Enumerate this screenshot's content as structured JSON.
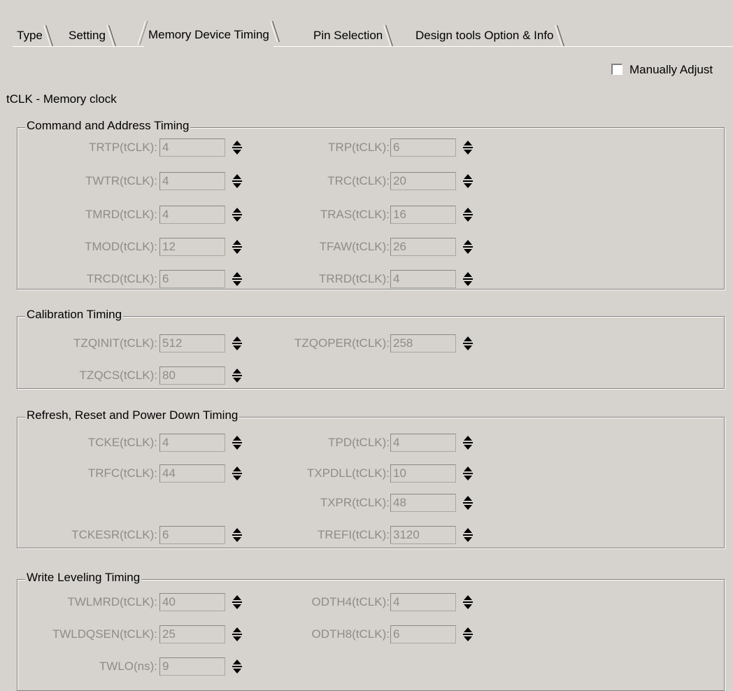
{
  "tabs": [
    {
      "label": "Type"
    },
    {
      "label": "Setting"
    },
    {
      "label": "Memory Device Timing",
      "active": true
    },
    {
      "label": "Pin Selection"
    },
    {
      "label": "Design tools Option & Info"
    }
  ],
  "manual_adjust": {
    "label": "Manually Adjust",
    "checked": false
  },
  "clock_label": "tCLK - Memory clock",
  "groups": {
    "command": {
      "title": "Command and Address Timing",
      "fields": [
        {
          "label": "TRTP(tCLK):",
          "value": "4"
        },
        {
          "label": "TRP(tCLK):",
          "value": "6"
        },
        {
          "label": "TWTR(tCLK):",
          "value": "4"
        },
        {
          "label": "TRC(tCLK):",
          "value": "20"
        },
        {
          "label": "TMRD(tCLK):",
          "value": "4"
        },
        {
          "label": "TRAS(tCLK):",
          "value": "16"
        },
        {
          "label": "TMOD(tCLK):",
          "value": "12"
        },
        {
          "label": "TFAW(tCLK):",
          "value": "26"
        },
        {
          "label": "TRCD(tCLK):",
          "value": "6"
        },
        {
          "label": "TRRD(tCLK):",
          "value": "4"
        }
      ]
    },
    "calibration": {
      "title": "Calibration Timing",
      "fields": [
        {
          "label": "TZQINIT(tCLK):",
          "value": "512"
        },
        {
          "label": "TZQOPER(tCLK):",
          "value": "258"
        },
        {
          "label": "TZQCS(tCLK):",
          "value": "80"
        }
      ]
    },
    "refresh": {
      "title": "Refresh, Reset and Power Down Timing",
      "fields": [
        {
          "label": "TCKE(tCLK):",
          "value": "4"
        },
        {
          "label": "TPD(tCLK):",
          "value": "4"
        },
        {
          "label": "TRFC(tCLK):",
          "value": "44"
        },
        {
          "label": "TXPDLL(tCLK):",
          "value": "10"
        },
        {
          "label": "TXPR(tCLK):",
          "value": "48"
        },
        {
          "label": "TCKESR(tCLK):",
          "value": "6"
        },
        {
          "label": "TREFI(tCLK):",
          "value": "3120"
        }
      ]
    },
    "write": {
      "title": "Write Leveling Timing",
      "fields": [
        {
          "label": "TWLMRD(tCLK):",
          "value": "40"
        },
        {
          "label": "ODTH4(tCLK):",
          "value": "4"
        },
        {
          "label": "TWLDQSEN(tCLK):",
          "value": "25"
        },
        {
          "label": "ODTH8(tCLK):",
          "value": "6"
        },
        {
          "label": "TWLO(ns):",
          "value": "9"
        }
      ]
    }
  },
  "colors": {
    "background": "#d6d3ce",
    "disabled_text": "#8e8c88"
  },
  "icons": {
    "spinner": "up-down-spin-arrows-icon"
  }
}
